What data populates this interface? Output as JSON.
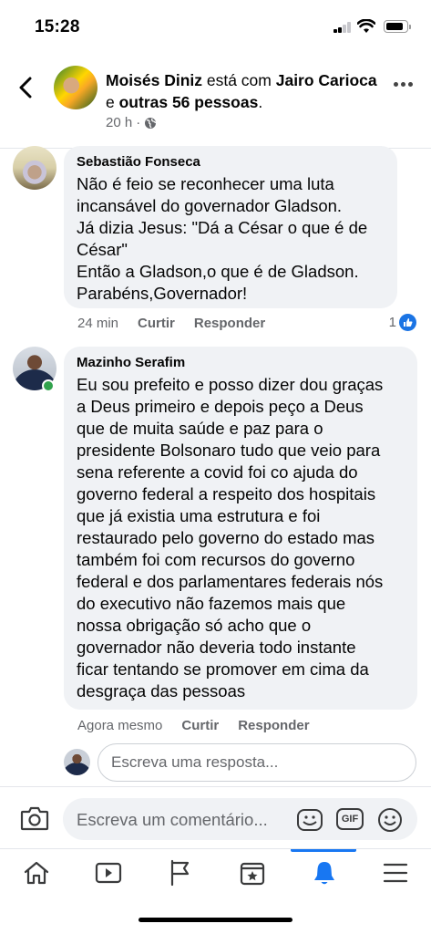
{
  "status_bar": {
    "time": "15:28"
  },
  "post_header": {
    "author": "Moisés Diniz",
    "connector": " está com ",
    "tagged": "Jairo Carioca",
    "connector2": " e ",
    "others": "outras 56 pessoas",
    "period": ".",
    "time": "20 h",
    "separator": "·",
    "privacy_icon": "globe-icon"
  },
  "comments": [
    {
      "author": "Sebastião Fonseca",
      "text": "Não é feio se reconhecer uma luta\nincansável do governador Gladson.\nJá dizia Jesus: \"Dá a César o que é de\nCésar\"\nEntão a Gladson,o que é de Gladson.\nParabéns,Governador!",
      "time": "24 min",
      "like_label": "Curtir",
      "reply_label": "Responder",
      "reaction_count": "1"
    },
    {
      "author": "Mazinho Serafim",
      "text": "Eu sou prefeito e posso dizer dou graças\na Deus primeiro e depois peço a Deus\nque de muita saúde e paz para o\npresidente Bolsonaro tudo que veio para\nsena referente a covid foi co ajuda do\ngoverno federal a respeito dos hospitais\nque já existia uma estrutura e foi\nrestaurado pelo governo do estado mas\ntambém foi com recursos do governo\nfederal e dos parlamentares federais nós\ndo executivo não fazemos mais que\nnossa obrigação só acho que o\ngovernador não deveria todo instante\nficar tentando se promover em cima da\ndesgraça das pessoas",
      "time": "Agora mesmo",
      "like_label": "Curtir",
      "reply_label": "Responder"
    }
  ],
  "reply_field": {
    "placeholder": "Escreva uma resposta..."
  },
  "composer": {
    "placeholder": "Escreva um comentário...",
    "gif_label": "GIF"
  },
  "bottom_nav": {
    "items": [
      "home-icon",
      "video-icon",
      "pages-flag-icon",
      "marketplace-icon",
      "notifications-bell-icon",
      "menu-icon"
    ],
    "active": "notifications-bell-icon",
    "accent": "#1877f2"
  },
  "colors": {
    "bubble": "#f0f2f5",
    "secondary_text": "#65676b",
    "online": "#31a24c",
    "like": "#1b74e4"
  }
}
